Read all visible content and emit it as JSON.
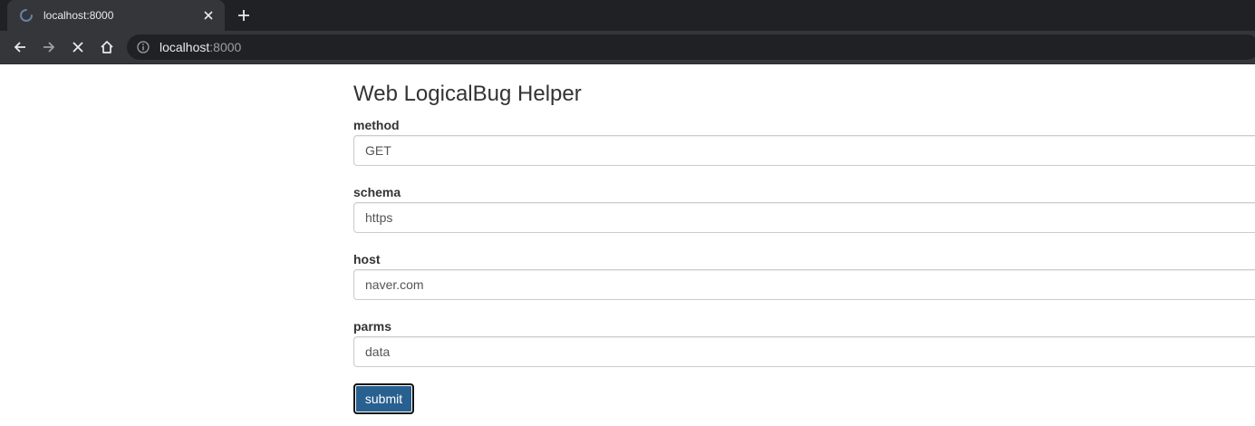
{
  "browser": {
    "tab_title": "localhost:8000",
    "url_host": "localhost",
    "url_port": ":8000",
    "icons": {
      "tab_spinner": "loading-spinner-icon",
      "tab_close": "close-icon",
      "new_tab": "plus-icon",
      "back": "arrow-left-icon",
      "forward": "arrow-right-icon",
      "stop": "close-icon",
      "home": "home-icon",
      "site_info": "info-icon"
    }
  },
  "form": {
    "title": "Web LogicalBug Helper",
    "fields": [
      {
        "label": "method",
        "value": "GET"
      },
      {
        "label": "schema",
        "value": "https"
      },
      {
        "label": "host",
        "value": "naver.com"
      },
      {
        "label": "parms",
        "value": "data"
      }
    ],
    "submit_label": "submit"
  },
  "colors": {
    "chrome_dark": "#202124",
    "chrome_toolbar": "#35363a",
    "button_primary": "#286090",
    "text": "#333333"
  }
}
